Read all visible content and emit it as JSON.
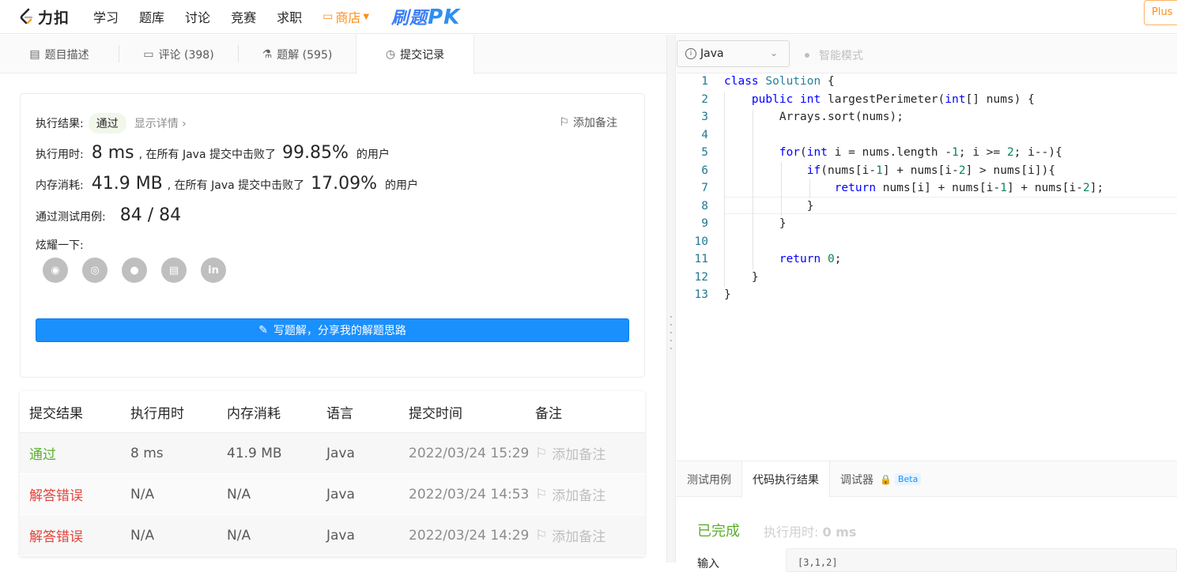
{
  "nav": {
    "logo_text": "力扣",
    "items": [
      "学习",
      "题库",
      "讨论",
      "竞赛",
      "求职"
    ],
    "shop": "商店",
    "pk_prefix": "刷题",
    "pk_suffix": "PK",
    "plus": "Plus"
  },
  "tabs": {
    "description": "题目描述",
    "comments": "评论 (398)",
    "solutions": "题解 (595)",
    "submissions": "提交记录"
  },
  "result": {
    "status_label": "执行结果:",
    "status": "通过",
    "show_detail": "显示详情",
    "add_note": "添加备注",
    "runtime_label": "执行用时:",
    "runtime_value": "8 ms",
    "runtime_text": ", 在所有 Java 提交中击败了",
    "runtime_pct": "99.85%",
    "users_text": "的用户",
    "memory_label": "内存消耗:",
    "memory_value": "41.9 MB",
    "memory_text": ", 在所有 Java 提交中击败了",
    "memory_pct": "17.09%",
    "cases_label": "通过测试用例:",
    "cases_value": "84 / 84",
    "share_label": "炫耀一下:",
    "write_btn": "写题解，分享我的解题思路"
  },
  "table": {
    "headers": [
      "提交结果",
      "执行用时",
      "内存消耗",
      "语言",
      "提交时间",
      "备注"
    ],
    "rows": [
      {
        "result": "通过",
        "runtime": "8 ms",
        "memory": "41.9 MB",
        "lang": "Java",
        "time": "2022/03/24 15:29",
        "note": "添加备注"
      },
      {
        "result": "解答错误",
        "runtime": "N/A",
        "memory": "N/A",
        "lang": "Java",
        "time": "2022/03/24 14:53",
        "note": "添加备注"
      },
      {
        "result": "解答错误",
        "runtime": "N/A",
        "memory": "N/A",
        "lang": "Java",
        "time": "2022/03/24 14:29",
        "note": "添加备注"
      }
    ]
  },
  "editor": {
    "language": "Java",
    "smart_mode": "智能模式",
    "line_numbers": [
      "1",
      "2",
      "3",
      "4",
      "5",
      "6",
      "7",
      "8",
      "9",
      "10",
      "11",
      "12",
      "13"
    ]
  },
  "console": {
    "tab_testcase": "测试用例",
    "tab_result": "代码执行结果",
    "tab_debugger": "调试器",
    "beta": "Beta",
    "done": "已完成",
    "exec_label": "执行用时:",
    "exec_value": "0 ms",
    "input_label": "输入",
    "input_value": "[3,1,2]"
  },
  "colors": {
    "accent": "#1a90ff",
    "pass": "#5aaf2e",
    "error": "#e2453c",
    "shop": "#ff8c1a"
  }
}
